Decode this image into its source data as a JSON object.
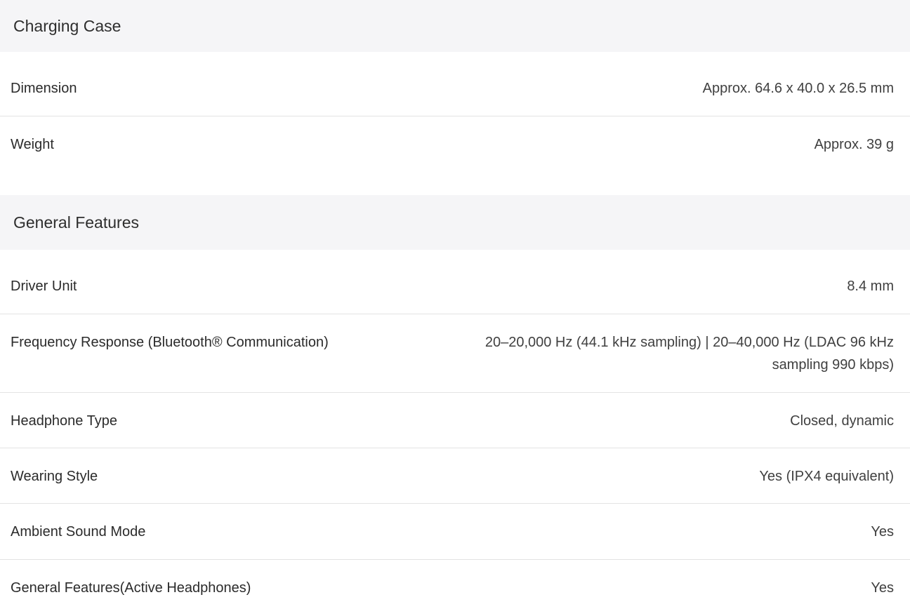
{
  "sections": [
    {
      "title": "Charging Case",
      "rows": [
        {
          "label": "Dimension",
          "value": "Approx. 64.6 x 40.0 x 26.5 mm"
        },
        {
          "label": "Weight",
          "value": "Approx. 39 g"
        }
      ]
    },
    {
      "title": "General Features",
      "rows": [
        {
          "label": "Driver Unit",
          "value": "8.4 mm"
        },
        {
          "label": "Frequency Response (Bluetooth® Communication)",
          "value": "20–20,000 Hz (44.1 kHz sampling) | 20–40,000 Hz (LDAC 96 kHz sampling 990 kbps)"
        },
        {
          "label": "Headphone Type",
          "value": "Closed, dynamic"
        },
        {
          "label": "Wearing Style",
          "value": "Yes (IPX4 equivalent)"
        },
        {
          "label": "Ambient Sound Mode",
          "value": "Yes"
        },
        {
          "label": "General Features(Active Headphones)",
          "value": "Yes"
        }
      ]
    }
  ]
}
